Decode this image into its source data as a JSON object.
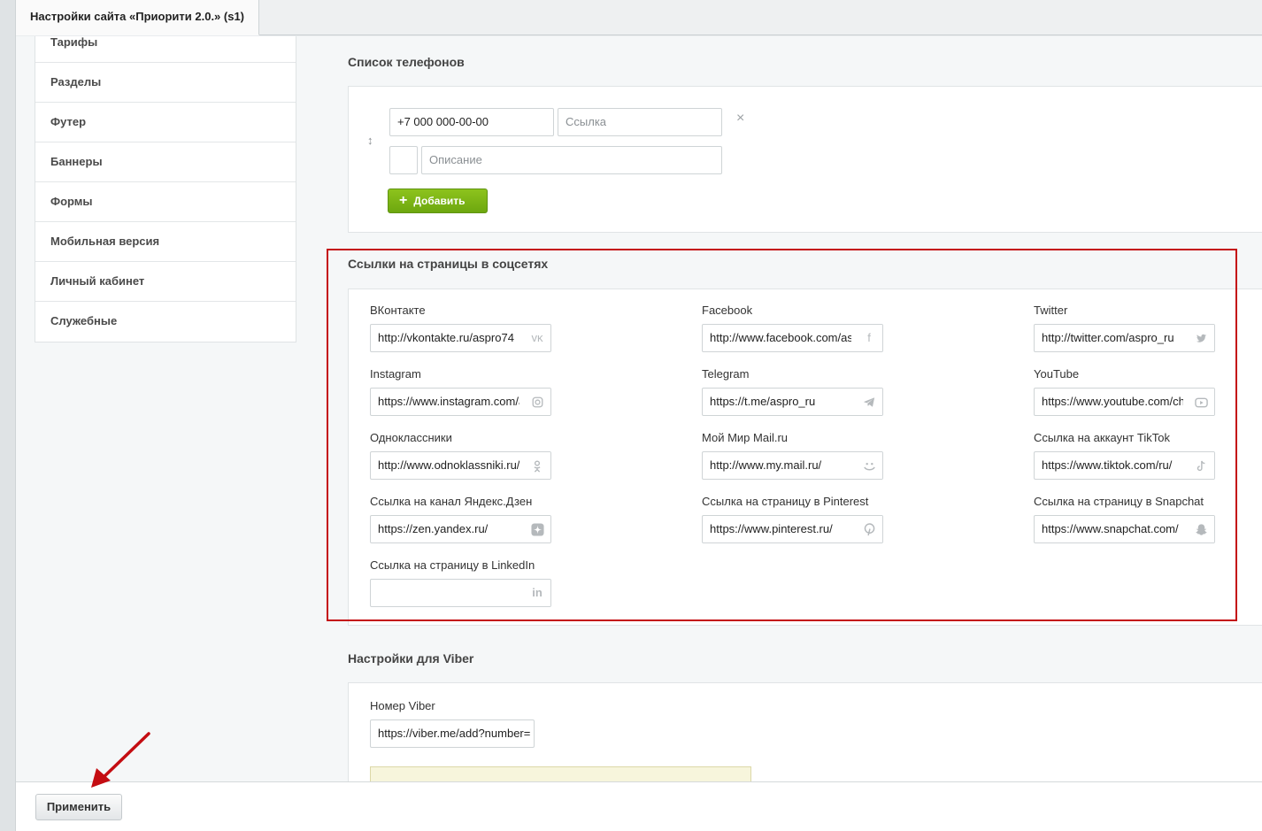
{
  "window": {
    "tab_title": "Настройки сайта «Приорити 2.0.» (s1)"
  },
  "sidebar": {
    "items": [
      {
        "label": "Тарифы"
      },
      {
        "label": "Разделы"
      },
      {
        "label": "Футер"
      },
      {
        "label": "Баннеры"
      },
      {
        "label": "Формы"
      },
      {
        "label": "Мобильная версия"
      },
      {
        "label": "Личный кабинет"
      },
      {
        "label": "Служебные"
      }
    ]
  },
  "phones": {
    "title": "Список телефонов",
    "phone_value": "+7 000 000-00-00",
    "link_placeholder": "Ссылка",
    "description_placeholder": "Описание",
    "remove_glyph": "×",
    "drag_glyph": "↕",
    "add_label": "Добавить"
  },
  "social": {
    "title": "Ссылки на страницы в соцсетях",
    "fields": [
      {
        "label": "ВКонтакте",
        "value": "http://vkontakte.ru/aspro74",
        "icon": "vk-icon"
      },
      {
        "label": "Facebook",
        "value": "http://www.facebook.com/aspro",
        "icon": "facebook-icon"
      },
      {
        "label": "Twitter",
        "value": "http://twitter.com/aspro_ru",
        "icon": "twitter-icon"
      },
      {
        "label": "Instagram",
        "value": "https://www.instagram.com/aspro",
        "icon": "instagram-icon"
      },
      {
        "label": "Telegram",
        "value": "https://t.me/aspro_ru",
        "icon": "telegram-icon"
      },
      {
        "label": "YouTube",
        "value": "https://www.youtube.com/channel",
        "icon": "youtube-icon"
      },
      {
        "label": "Одноклассники",
        "value": "http://www.odnoklassniki.ru/",
        "icon": "odnoklassniki-icon"
      },
      {
        "label": "Мой Мир Mail.ru",
        "value": "http://www.my.mail.ru/",
        "icon": "mymail-icon"
      },
      {
        "label": "Ссылка на аккаунт TikTok",
        "value": "https://www.tiktok.com/ru/",
        "icon": "tiktok-icon"
      },
      {
        "label": "Ссылка на канал Яндекс.Дзен",
        "value": "https://zen.yandex.ru/",
        "icon": "zen-icon"
      },
      {
        "label": "Ссылка на страницу в Pinterest",
        "value": "https://www.pinterest.ru/",
        "icon": "pinterest-icon"
      },
      {
        "label": "Ссылка на страницу в Snapchat",
        "value": "https://www.snapchat.com/",
        "icon": "snapchat-icon"
      },
      {
        "label": "Ссылка на страницу в LinkedIn",
        "value": "",
        "icon": "linkedin-icon"
      }
    ]
  },
  "viber": {
    "title": "Настройки для Viber",
    "number_label": "Номер Viber",
    "number_value": "https://viber.me/add?number="
  },
  "footer": {
    "apply_label": "Применить"
  },
  "colors": {
    "highlight": "#c40d12",
    "add_button": "#7ab516",
    "arrow": "#c40d12"
  }
}
